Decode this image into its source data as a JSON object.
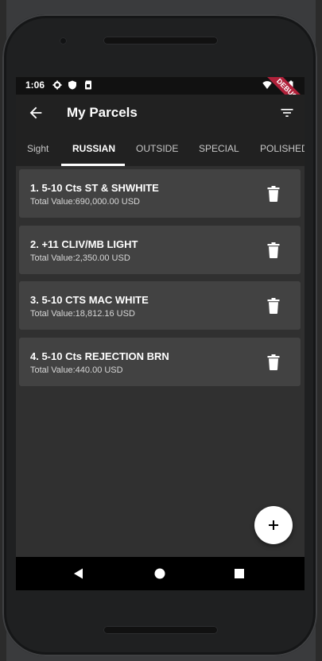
{
  "status_bar": {
    "time": "1:06"
  },
  "debug_banner": "DEBUG",
  "app_bar": {
    "title": "My Parcels"
  },
  "tabs": [
    {
      "label": "Sight",
      "active": false
    },
    {
      "label": "RUSSIAN",
      "active": true
    },
    {
      "label": "OUTSIDE",
      "active": false
    },
    {
      "label": "SPECIAL",
      "active": false
    },
    {
      "label": "POLISHED",
      "active": false
    }
  ],
  "parcels": [
    {
      "title": "1. 5-10 Cts ST & SHWHITE",
      "total": "Total Value:690,000.00 USD"
    },
    {
      "title": "2. +11 CLIV/MB LIGHT",
      "total": "Total Value:2,350.00 USD"
    },
    {
      "title": "3. 5-10 CTS MAC WHITE",
      "total": "Total Value:18,812.16 USD"
    },
    {
      "title": "4. 5-10 Cts REJECTION BRN",
      "total": "Total Value:440.00 USD"
    }
  ],
  "colors": {
    "background": "#303030",
    "app_bar": "#212121",
    "card": "#424242",
    "fab": "#ffffff",
    "debug_ribbon": "#b0213a"
  },
  "icons": {
    "back": "arrow-back-icon",
    "filter": "filter-icon",
    "delete": "trash-icon",
    "add": "plus-icon"
  }
}
